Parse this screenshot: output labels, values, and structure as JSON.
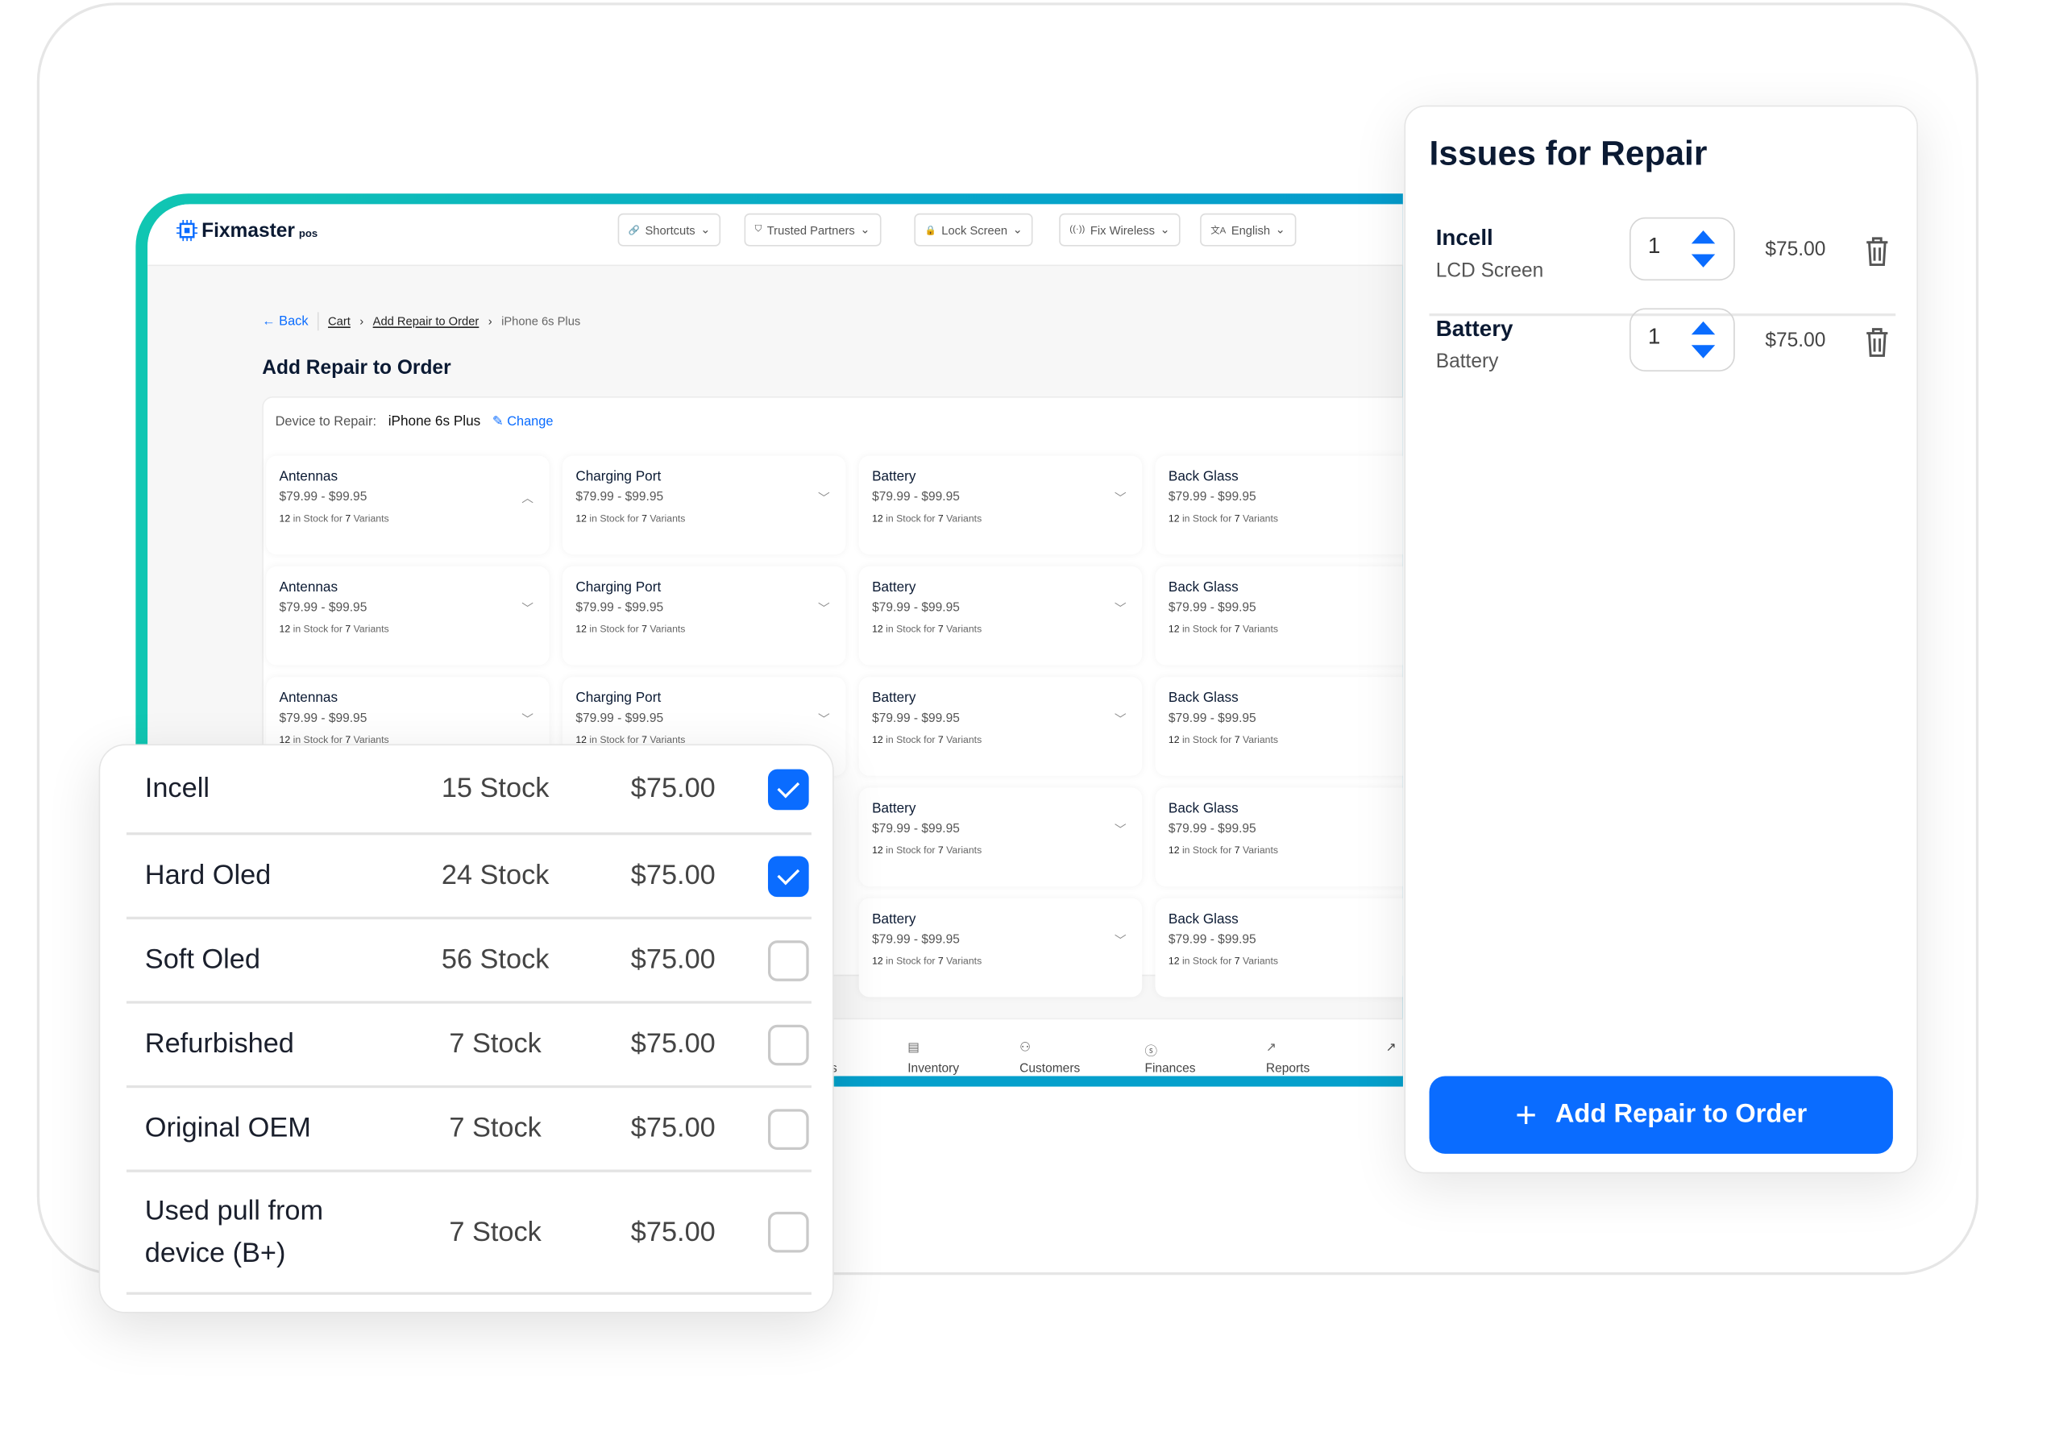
{
  "header": {
    "brand": "Fixmaster",
    "brand_suffix": "pos",
    "dropdowns": [
      {
        "label": "Shortcuts",
        "icon": "link-icon"
      },
      {
        "label": "Trusted Partners",
        "icon": "shield-icon"
      },
      {
        "label": "Lock Screen",
        "icon": "lock-icon"
      },
      {
        "label": "Fix Wireless",
        "icon": "wireless-icon"
      },
      {
        "label": "English",
        "icon": "translate-icon"
      }
    ]
  },
  "breadcrumb": {
    "back": "Back",
    "items": [
      "Cart",
      "Add Repair to Order"
    ],
    "current": "iPhone 6s Plus"
  },
  "page_title": "Add Repair to Order",
  "device": {
    "label": "Device to Repair:",
    "value": "iPhone 6s Plus",
    "change": "Change"
  },
  "parts_rows": [
    [
      {
        "name": "Antennas",
        "price": "$79.99 - $99.95",
        "stock": "12",
        "variants": "7",
        "expanded": true
      },
      {
        "name": "Charging Port",
        "price": "$79.99 - $99.95",
        "stock": "12",
        "variants": "7"
      },
      {
        "name": "Battery",
        "price": "$79.99 - $99.95",
        "stock": "12",
        "variants": "7"
      },
      {
        "name": "Back Glass",
        "price": "$79.99 - $99.95",
        "stock": "12",
        "variants": "7"
      }
    ],
    [
      {
        "name": "Antennas",
        "price": "$79.99 - $99.95",
        "stock": "12",
        "variants": "7"
      },
      {
        "name": "Charging Port",
        "price": "$79.99 - $99.95",
        "stock": "12",
        "variants": "7"
      },
      {
        "name": "Battery",
        "price": "$79.99 - $99.95",
        "stock": "12",
        "variants": "7"
      },
      {
        "name": "Back Glass",
        "price": "$79.99 - $99.95",
        "stock": "12",
        "variants": "7"
      }
    ],
    [
      {
        "name": "Antennas",
        "price": "$79.99 - $99.95",
        "stock": "12",
        "variants": "7"
      },
      {
        "name": "Charging Port",
        "price": "$79.99 - $99.95",
        "stock": "12",
        "variants": "7"
      },
      {
        "name": "Battery",
        "price": "$79.99 - $99.95",
        "stock": "12",
        "variants": "7"
      },
      {
        "name": "Back Glass",
        "price": "$79.99 - $99.95",
        "stock": "12",
        "variants": "7"
      }
    ],
    [
      {
        "name": "Battery",
        "price": "$79.99 - $99.95",
        "stock": "12",
        "variants": "7"
      },
      {
        "name": "Back Glass",
        "price": "$79.99 - $99.95",
        "stock": "12",
        "variants": "7"
      }
    ],
    [
      {
        "name": "Battery",
        "price": "$79.99 - $99.95",
        "stock": "12",
        "variants": "7"
      },
      {
        "name": "Back Glass",
        "price": "$79.99 - $99.95",
        "stock": "12",
        "variants": "7"
      }
    ]
  ],
  "stock_text": {
    "in": "in Stock for",
    "variants": "Variants"
  },
  "bottom_nav": [
    {
      "label": "Products",
      "icon": "box-icon"
    },
    {
      "label": "Inventory",
      "icon": "table-icon"
    },
    {
      "label": "Customers",
      "icon": "users-icon"
    },
    {
      "label": "Finances",
      "icon": "dollar-icon"
    },
    {
      "label": "Reports",
      "icon": "trend-icon"
    }
  ],
  "variants": [
    {
      "name": "Incell",
      "stock": "15 Stock",
      "price": "$75.00",
      "checked": true
    },
    {
      "name": "Hard Oled",
      "stock": "24 Stock",
      "price": "$75.00",
      "checked": true
    },
    {
      "name": "Soft Oled",
      "stock": "56 Stock",
      "price": "$75.00",
      "checked": false
    },
    {
      "name": "Refurbished",
      "stock": "7 Stock",
      "price": "$75.00",
      "checked": false
    },
    {
      "name": "Original OEM",
      "stock": "7 Stock",
      "price": "$75.00",
      "checked": false
    },
    {
      "name": "Used pull from device (B+)",
      "stock": "7 Stock",
      "price": "$75.00",
      "checked": false
    }
  ],
  "issues": {
    "title": "Issues for Repair",
    "items": [
      {
        "name": "Incell",
        "sub": "LCD Screen",
        "qty": "1",
        "price": "$75.00"
      },
      {
        "name": "Battery",
        "sub": "Battery",
        "qty": "1",
        "price": "$75.00"
      }
    ],
    "add_button": "Add Repair to Order"
  },
  "colors": {
    "accent": "#0a6cff",
    "teal": "#10c6b2",
    "frame_blue": "#059ccc"
  }
}
